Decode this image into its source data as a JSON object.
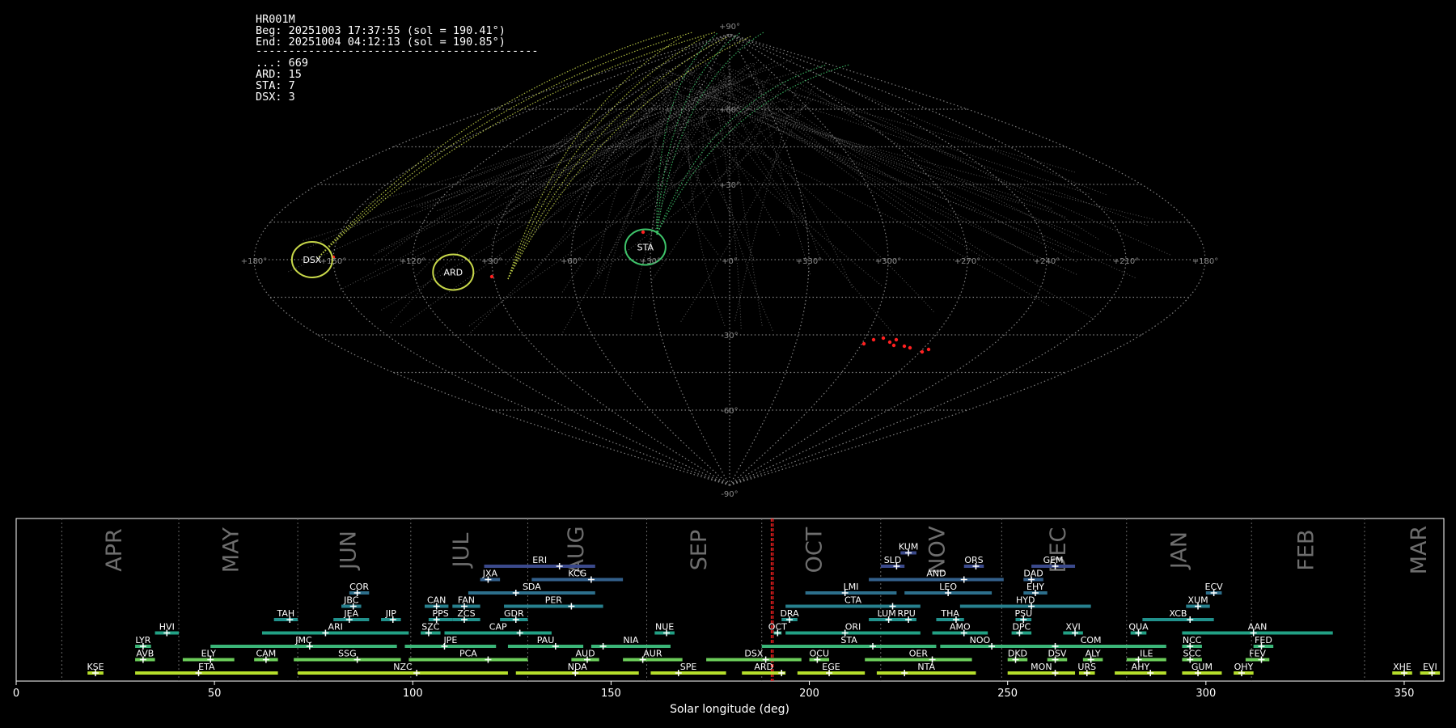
{
  "info": {
    "station": "HR001M",
    "beg": "Beg: 20251003 17:37:55 (sol = 190.41°)",
    "end": "End: 20251004 04:12:13 (sol = 190.85°)",
    "separator": "-------------------------------------------",
    "counts": [
      "...: 669",
      "ARD: 15",
      "STA: 7",
      "DSX: 3"
    ]
  },
  "colors": {
    "background": "#000000",
    "grid": "#808080",
    "sporadic": "#9a9a9a",
    "ard_dsx": "#c8d84a",
    "sta": "#3ec46a",
    "highlight": "#ff2020",
    "frame": "#ffffff"
  },
  "skymap": {
    "projection": "sinusoidal",
    "lon_labels": [
      "+180°",
      "+150°",
      "+120°",
      "+90°",
      "+60°",
      "+30°",
      "+0°",
      "+330°",
      "+300°",
      "+270°",
      "+240°",
      "+210°",
      "+180°"
    ],
    "lat_labels": [
      "+90°",
      "+60°",
      "+30°",
      "-30°",
      "-60°",
      "-90°"
    ],
    "radiants": [
      {
        "code": "DSX",
        "lon": 158,
        "lat": 0,
        "color": "#c8d84a"
      },
      {
        "code": "ARD",
        "lon": 105,
        "lat": -5,
        "color": "#c8d84a"
      },
      {
        "code": "STA",
        "lon": 32,
        "lat": 5,
        "color": "#3ec46a"
      }
    ]
  },
  "chart_data": {
    "type": "timeline",
    "xlabel": "Solar longitude (deg)",
    "xlim": [
      0,
      360
    ],
    "xticks": [
      0,
      50,
      100,
      150,
      200,
      250,
      300,
      350
    ],
    "current_sol": [
      190.41,
      190.85
    ],
    "months": [
      {
        "label": "APR",
        "start": 11.5,
        "center": 25
      },
      {
        "label": "MAY",
        "start": 41,
        "center": 54.5
      },
      {
        "label": "JUN",
        "start": 71,
        "center": 84
      },
      {
        "label": "JUL",
        "start": 99.5,
        "center": 112.5
      },
      {
        "label": "AUG",
        "start": 129,
        "center": 141.5
      },
      {
        "label": "SEP",
        "start": 159,
        "center": 172.5
      },
      {
        "label": "OCT",
        "start": 188,
        "center": 201.5
      },
      {
        "label": "NOV",
        "start": 218,
        "center": 232.5
      },
      {
        "label": "DEC",
        "start": 248.5,
        "center": 263
      },
      {
        "label": "JAN",
        "start": 280,
        "center": 293.5
      },
      {
        "label": "FEB",
        "start": 311.5,
        "center": 325.5
      },
      {
        "label": "MAR",
        "start": 340,
        "center": 354
      }
    ],
    "showers": [
      {
        "code": "KUM",
        "start": 223,
        "end": 227,
        "peak": 225,
        "row": 8,
        "color": "#3b4a8c"
      },
      {
        "code": "ERI",
        "start": 118,
        "end": 146,
        "peak": 137,
        "row": 7,
        "color": "#3b4a8c"
      },
      {
        "code": "SLD",
        "start": 218,
        "end": 224,
        "peak": 222,
        "row": 7,
        "color": "#3b4a8c"
      },
      {
        "code": "ORS",
        "start": 239,
        "end": 244,
        "peak": 242,
        "row": 7,
        "color": "#3b4a8c"
      },
      {
        "code": "GEM",
        "start": 256,
        "end": 267,
        "peak": 262,
        "row": 7,
        "color": "#3b4a8c"
      },
      {
        "code": "JXA",
        "start": 117,
        "end": 122,
        "peak": 119,
        "row": 6,
        "color": "#33608c"
      },
      {
        "code": "KCG",
        "start": 130,
        "end": 153,
        "peak": 145,
        "row": 6,
        "color": "#33608c"
      },
      {
        "code": "AND",
        "start": 215,
        "end": 249,
        "peak": 239,
        "row": 6,
        "color": "#33608c"
      },
      {
        "code": "DAD",
        "start": 254,
        "end": 259,
        "peak": 256,
        "row": 6,
        "color": "#33608c"
      },
      {
        "code": "COR",
        "start": 84,
        "end": 89,
        "peak": 86,
        "row": 5,
        "color": "#2d6f8c"
      },
      {
        "code": "SDA",
        "start": 114,
        "end": 146,
        "peak": 126,
        "row": 5,
        "color": "#2d6f8c"
      },
      {
        "code": "LMI",
        "start": 199,
        "end": 222,
        "peak": 209,
        "row": 5,
        "color": "#2d6f8c"
      },
      {
        "code": "LEO",
        "start": 224,
        "end": 246,
        "peak": 235,
        "row": 5,
        "color": "#2d6f8c"
      },
      {
        "code": "EHY",
        "start": 254,
        "end": 260,
        "peak": 257,
        "row": 5,
        "color": "#2d6f8c"
      },
      {
        "code": "ECV",
        "start": 300,
        "end": 304,
        "peak": 302,
        "row": 5,
        "color": "#2d6f8c"
      },
      {
        "code": "JBC",
        "start": 82,
        "end": 87,
        "peak": 85,
        "row": 4,
        "color": "#27808e"
      },
      {
        "code": "CAN",
        "start": 103,
        "end": 109,
        "peak": 106,
        "row": 4,
        "color": "#27808e"
      },
      {
        "code": "FAN",
        "start": 110,
        "end": 117,
        "peak": 113,
        "row": 4,
        "color": "#27808e"
      },
      {
        "code": "PER",
        "start": 123,
        "end": 148,
        "peak": 140,
        "row": 4,
        "color": "#27808e"
      },
      {
        "code": "CTA",
        "start": 194,
        "end": 228,
        "peak": 221,
        "row": 4,
        "color": "#27808e"
      },
      {
        "code": "HYD",
        "start": 238,
        "end": 271,
        "peak": 256,
        "row": 4,
        "color": "#27808e"
      },
      {
        "code": "XUM",
        "start": 295,
        "end": 301,
        "peak": 298,
        "row": 4,
        "color": "#27808e"
      },
      {
        "code": "TAH",
        "start": 65,
        "end": 71,
        "peak": 69,
        "row": 3,
        "color": "#21918c"
      },
      {
        "code": "JEA",
        "start": 80,
        "end": 89,
        "peak": 84,
        "row": 3,
        "color": "#21918c"
      },
      {
        "code": "JIP",
        "start": 92,
        "end": 97,
        "peak": 95,
        "row": 3,
        "color": "#21918c"
      },
      {
        "code": "PPS",
        "start": 104,
        "end": 110,
        "peak": 106,
        "row": 3,
        "color": "#21918c"
      },
      {
        "code": "ZCS",
        "start": 110,
        "end": 117,
        "peak": 113,
        "row": 3,
        "color": "#21918c"
      },
      {
        "code": "GDR",
        "start": 122,
        "end": 129,
        "peak": 126,
        "row": 3,
        "color": "#21918c"
      },
      {
        "code": "DRA",
        "start": 193,
        "end": 197,
        "peak": 195,
        "row": 3,
        "color": "#21918c"
      },
      {
        "code": "LUM",
        "start": 215,
        "end": 224,
        "peak": 220,
        "row": 3,
        "color": "#21918c"
      },
      {
        "code": "RPU",
        "start": 222,
        "end": 227,
        "peak": 225,
        "row": 3,
        "color": "#21918c"
      },
      {
        "code": "THA",
        "start": 232,
        "end": 239,
        "peak": 237,
        "row": 3,
        "color": "#21918c"
      },
      {
        "code": "PSU",
        "start": 252,
        "end": 256,
        "peak": 254,
        "row": 3,
        "color": "#21918c"
      },
      {
        "code": "XCB",
        "start": 284,
        "end": 302,
        "peak": 296,
        "row": 3,
        "color": "#21918c"
      },
      {
        "code": "HVI",
        "start": 35,
        "end": 41,
        "peak": 38,
        "row": 2,
        "color": "#22a185"
      },
      {
        "code": "ARI",
        "start": 62,
        "end": 99,
        "peak": 78,
        "row": 2,
        "color": "#22a185"
      },
      {
        "code": "SZC",
        "start": 102,
        "end": 107,
        "peak": 104,
        "row": 2,
        "color": "#22a185"
      },
      {
        "code": "CAP",
        "start": 108,
        "end": 135,
        "peak": 127,
        "row": 2,
        "color": "#22a185"
      },
      {
        "code": "NUE",
        "start": 161,
        "end": 166,
        "peak": 164,
        "row": 2,
        "color": "#22a185"
      },
      {
        "code": "OCT",
        "start": 191,
        "end": 193,
        "peak": 192,
        "row": 2,
        "color": "#22a185"
      },
      {
        "code": "ORI",
        "start": 194,
        "end": 228,
        "peak": 209,
        "row": 2,
        "color": "#22a185"
      },
      {
        "code": "AMO",
        "start": 231,
        "end": 245,
        "peak": 239,
        "row": 2,
        "color": "#22a185"
      },
      {
        "code": "DPC",
        "start": 251,
        "end": 256,
        "peak": 253,
        "row": 2,
        "color": "#22a185"
      },
      {
        "code": "XVI",
        "start": 264,
        "end": 269,
        "peak": 267,
        "row": 2,
        "color": "#22a185"
      },
      {
        "code": "QUA",
        "start": 281,
        "end": 285,
        "peak": 283,
        "row": 2,
        "color": "#22a185"
      },
      {
        "code": "AAN",
        "start": 294,
        "end": 332,
        "peak": 312,
        "row": 2,
        "color": "#22a185"
      },
      {
        "code": "LYR",
        "start": 30,
        "end": 34,
        "peak": 32,
        "row": 1,
        "color": "#3bb578"
      },
      {
        "code": "JMC",
        "start": 49,
        "end": 96,
        "peak": 74,
        "row": 1,
        "color": "#3bb578"
      },
      {
        "code": "JPE",
        "start": 98,
        "end": 121,
        "peak": 108,
        "row": 1,
        "color": "#3bb578"
      },
      {
        "code": "PAU",
        "start": 124,
        "end": 143,
        "peak": 136,
        "row": 1,
        "color": "#3bb578"
      },
      {
        "code": "NIA",
        "start": 145,
        "end": 165,
        "peak": 148,
        "row": 1,
        "color": "#3bb578"
      },
      {
        "code": "STA",
        "start": 188,
        "end": 232,
        "peak": 216,
        "row": 1,
        "color": "#3bb578"
      },
      {
        "code": "NOO",
        "start": 233,
        "end": 253,
        "peak": 246,
        "row": 1,
        "color": "#3bb578"
      },
      {
        "code": "COM",
        "start": 252,
        "end": 290,
        "peak": 262,
        "row": 1,
        "color": "#3bb578"
      },
      {
        "code": "NCC",
        "start": 294,
        "end": 299,
        "peak": 296,
        "row": 1,
        "color": "#3bb578"
      },
      {
        "code": "FED",
        "start": 312,
        "end": 317,
        "peak": 314,
        "row": 1,
        "color": "#3bb578"
      },
      {
        "code": "AVB",
        "start": 30,
        "end": 35,
        "peak": 32,
        "row": 0,
        "color": "#6ccd5a"
      },
      {
        "code": "ELY",
        "start": 42,
        "end": 55,
        "peak": 49,
        "row": 0,
        "color": "#6ccd5a"
      },
      {
        "code": "CAM",
        "start": 60,
        "end": 66,
        "peak": 63,
        "row": 0,
        "color": "#6ccd5a"
      },
      {
        "code": "SSG",
        "start": 70,
        "end": 97,
        "peak": 86,
        "row": 0,
        "color": "#6ccd5a"
      },
      {
        "code": "PCA",
        "start": 99,
        "end": 129,
        "peak": 119,
        "row": 0,
        "color": "#6ccd5a"
      },
      {
        "code": "AUD",
        "start": 140,
        "end": 147,
        "peak": 144,
        "row": 0,
        "color": "#6ccd5a"
      },
      {
        "code": "AUR",
        "start": 153,
        "end": 168,
        "peak": 158,
        "row": 0,
        "color": "#6ccd5a"
      },
      {
        "code": "DSX",
        "start": 174,
        "end": 198,
        "peak": 189,
        "row": 0,
        "color": "#6ccd5a"
      },
      {
        "code": "OCU",
        "start": 200,
        "end": 205,
        "peak": 202,
        "row": 0,
        "color": "#6ccd5a"
      },
      {
        "code": "OER",
        "start": 214,
        "end": 241,
        "peak": 231,
        "row": 0,
        "color": "#6ccd5a"
      },
      {
        "code": "DKD",
        "start": 250,
        "end": 255,
        "peak": 252,
        "row": 0,
        "color": "#6ccd5a"
      },
      {
        "code": "DSV",
        "start": 260,
        "end": 265,
        "peak": 262,
        "row": 0,
        "color": "#6ccd5a"
      },
      {
        "code": "ALY",
        "start": 269,
        "end": 274,
        "peak": 271,
        "row": 0,
        "color": "#6ccd5a"
      },
      {
        "code": "ILE",
        "start": 280,
        "end": 290,
        "peak": 283,
        "row": 0,
        "color": "#6ccd5a"
      },
      {
        "code": "SCC",
        "start": 294,
        "end": 299,
        "peak": 296,
        "row": 0,
        "color": "#6ccd5a"
      },
      {
        "code": "FEV",
        "start": 310,
        "end": 316,
        "peak": 314,
        "row": 0,
        "color": "#6ccd5a"
      },
      {
        "code": "KSE",
        "start": 18,
        "end": 22,
        "peak": 20,
        "row": -1,
        "color": "#b5de2b"
      },
      {
        "code": "ETA",
        "start": 30,
        "end": 66,
        "peak": 46,
        "row": -1,
        "color": "#b5de2b"
      },
      {
        "code": "NZC",
        "start": 71,
        "end": 124,
        "peak": 101,
        "row": -1,
        "color": "#b5de2b"
      },
      {
        "code": "NDA",
        "start": 126,
        "end": 157,
        "peak": 141,
        "row": -1,
        "color": "#b5de2b"
      },
      {
        "code": "SPE",
        "start": 160,
        "end": 179,
        "peak": 167,
        "row": -1,
        "color": "#b5de2b"
      },
      {
        "code": "ARD",
        "start": 183,
        "end": 194,
        "peak": 193,
        "row": -1,
        "color": "#b5de2b"
      },
      {
        "code": "EGE",
        "start": 197,
        "end": 214,
        "peak": 205,
        "row": -1,
        "color": "#b5de2b"
      },
      {
        "code": "NTA",
        "start": 217,
        "end": 242,
        "peak": 224,
        "row": -1,
        "color": "#b5de2b"
      },
      {
        "code": "MON",
        "start": 250,
        "end": 267,
        "peak": 262,
        "row": -1,
        "color": "#b5de2b"
      },
      {
        "code": "URS",
        "start": 268,
        "end": 272,
        "peak": 270,
        "row": -1,
        "color": "#b5de2b"
      },
      {
        "code": "AHY",
        "start": 277,
        "end": 290,
        "peak": 286,
        "row": -1,
        "color": "#b5de2b"
      },
      {
        "code": "GUM",
        "start": 294,
        "end": 304,
        "peak": 298,
        "row": -1,
        "color": "#b5de2b"
      },
      {
        "code": "OHY",
        "start": 307,
        "end": 312,
        "peak": 309,
        "row": -1,
        "color": "#b5de2b"
      },
      {
        "code": "XHE",
        "start": 347,
        "end": 352,
        "peak": 350,
        "row": -1,
        "color": "#b5de2b"
      },
      {
        "code": "EVI",
        "start": 354,
        "end": 359,
        "peak": 357,
        "row": -1,
        "color": "#b5de2b"
      }
    ]
  }
}
